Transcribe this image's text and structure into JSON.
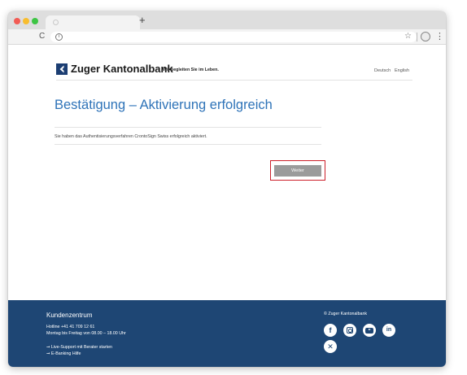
{
  "browser": {
    "new_tab_icon": "plus-icon",
    "reload_glyph": "C",
    "info_glyph": "i",
    "bookmark_icon": "star-icon",
    "menu_glyph": "⋮"
  },
  "header": {
    "brand_name": "Zuger Kantonalbank",
    "slogan": "Wir begleiten Sie im Leben.",
    "lang_de": "Deutsch",
    "lang_en": "English"
  },
  "main": {
    "title": "Bestätigung – Aktivierung erfolgreich",
    "message": "Sie haben das Authentisierungsverfahren CrontoSign Swiss erfolgreich aktiviert.",
    "continue_button": "Weiter"
  },
  "footer": {
    "title": "Kundenzentrum",
    "hotline": "Hotline +41 41 709 12 61",
    "hours": "Montag bis Freitag von 08.00 – 18.00 Uhr",
    "live_support": "➞ Live-Support mit Berater starten",
    "ebanking_help": "➞ E-Banking Hilfe",
    "copyright": "© Zuger Kantonalbank",
    "social": {
      "facebook": "f",
      "linkedin": "in",
      "xing": "✕"
    }
  },
  "colors": {
    "brand_blue": "#1c3e73",
    "title_blue": "#2e73b8",
    "footer_bg": "#1e4674",
    "button_gray": "#9b9b9b",
    "highlight_red": "#cc1f2a"
  }
}
